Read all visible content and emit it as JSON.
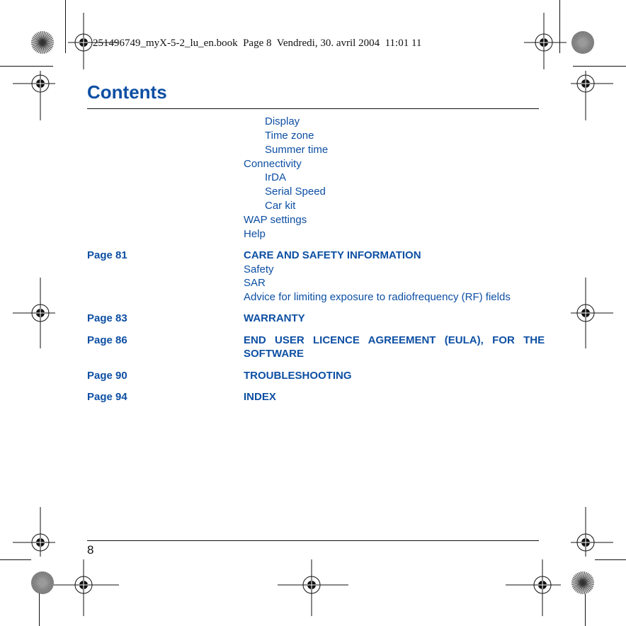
{
  "slug_line": "251496749_myX-5-2_lu_en.book  Page 8  Vendredi, 30. avril 2004  11:01 11",
  "page_title": "Contents",
  "colors": {
    "accent": "#0d4fa3",
    "text": "#111111"
  },
  "entries": [
    {
      "level": 2,
      "text": "Display"
    },
    {
      "level": 2,
      "text": "Time zone"
    },
    {
      "level": 2,
      "text": "Summer time"
    },
    {
      "level": 1,
      "text": "Connectivity"
    },
    {
      "level": 2,
      "text": "IrDA"
    },
    {
      "level": 2,
      "text": "Serial Speed"
    },
    {
      "level": 2,
      "text": "Car kit"
    },
    {
      "level": 1,
      "text": "WAP settings"
    },
    {
      "level": 1,
      "text": "Help"
    }
  ],
  "sections": [
    {
      "page": "Page 81",
      "title": "CARE AND SAFETY INFORMATION",
      "subitems": [
        "Safety",
        "SAR",
        "Advice for limiting exposure to radiofrequency (RF) fields"
      ]
    },
    {
      "page": "Page 83",
      "title": "WARRANTY",
      "subitems": []
    },
    {
      "page": "Page 86",
      "title_line1": "END  USER  LICENCE  AGREEMENT  (EULA),  FOR  THE",
      "title_line2": "SOFTWARE",
      "subitems": []
    },
    {
      "page": "Page 90",
      "title": "TROUBLESHOOTING",
      "subitems": []
    },
    {
      "page": "Page 94",
      "title": "INDEX",
      "subitems": []
    }
  ],
  "folio": "8",
  "print_marks": [
    "registration-mark",
    "color-bar-star"
  ]
}
